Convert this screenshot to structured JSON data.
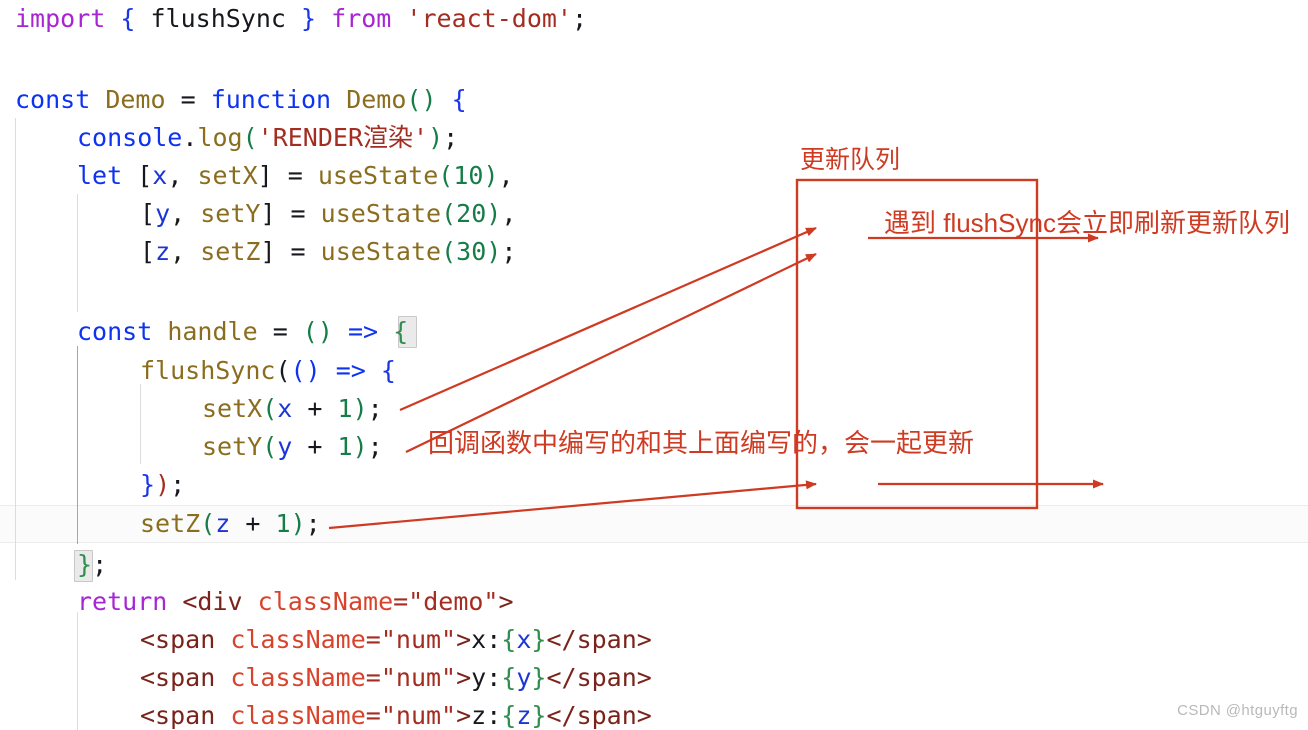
{
  "editor": {
    "font_size_px": 25,
    "line_height_px": 38,
    "background": "#ffffff",
    "current_line_background": "#fbfbfb",
    "indent_guide_color": "#dcdcdc",
    "active_indent_guide_color": "#a6a6a6",
    "lines": [
      {
        "id": "line-1",
        "text": "import { flushSync } from 'react-dom';"
      },
      {
        "id": "line-2",
        "text": ""
      },
      {
        "id": "line-3",
        "text": "const Demo = function Demo() {"
      },
      {
        "id": "line-4",
        "text": "    console.log('RENDER渲染');"
      },
      {
        "id": "line-5",
        "text": "    let [x, setX] = useState(10),"
      },
      {
        "id": "line-6",
        "text": "        [y, setY] = useState(20),"
      },
      {
        "id": "line-7",
        "text": "        [z, setZ] = useState(30);"
      },
      {
        "id": "line-8",
        "text": ""
      },
      {
        "id": "line-9",
        "text": "    const handle = () => {"
      },
      {
        "id": "line-10",
        "text": "        flushSync(() => {"
      },
      {
        "id": "line-11",
        "text": "            setX(x + 1);"
      },
      {
        "id": "line-12",
        "text": "            setY(y + 1);"
      },
      {
        "id": "line-13",
        "text": "        });"
      },
      {
        "id": "line-14",
        "text": "        setZ(z + 1);"
      },
      {
        "id": "line-15",
        "text": "    };"
      },
      {
        "id": "line-16",
        "text": "    return <div className=\"demo\">"
      },
      {
        "id": "line-17",
        "text": "        <span className=\"num\">x:{x}</span>"
      },
      {
        "id": "line-18",
        "text": "        <span className=\"num\">y:{y}</span>"
      },
      {
        "id": "line-19",
        "text": "        <span className=\"num\">z:{z}</span>"
      }
    ]
  },
  "annotations": {
    "color": "#cf3a22",
    "queue_box_label": "更新队列",
    "flush_sync_note": "遇到 flushSync会立即刷新更新队列",
    "callback_note": "回调函数中编写的和其上面编写的，会一起更新"
  },
  "watermark": {
    "text": "CSDN @htguyftg"
  }
}
